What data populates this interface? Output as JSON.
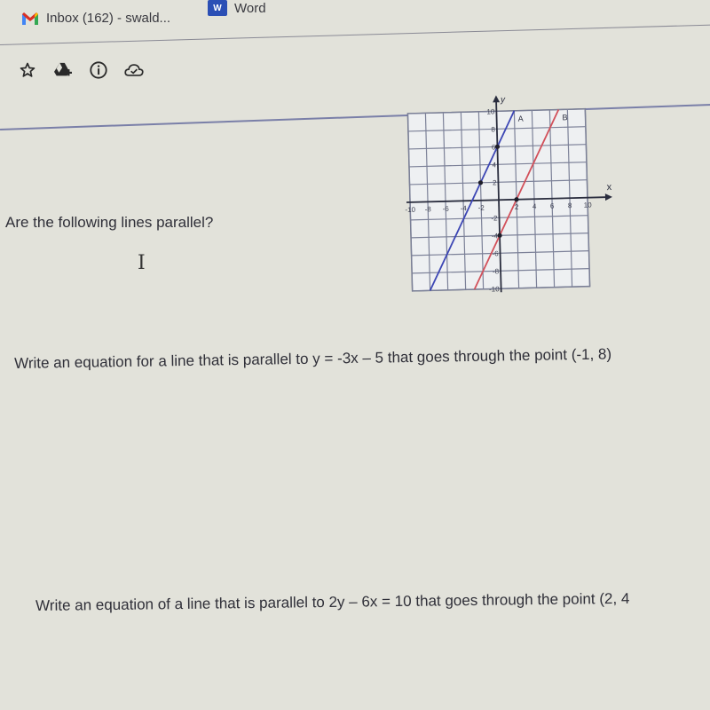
{
  "bookmarks": {
    "items": [
      {
        "label": "Inbox (162) - swald...",
        "icon": "gmail-icon"
      },
      {
        "label": "Word",
        "icon": "word-icon",
        "icon_text": "W"
      }
    ]
  },
  "toolbar": {
    "icons": [
      "star-icon",
      "drive-add-icon",
      "info-icon",
      "cloud-check-icon"
    ]
  },
  "questions": [
    {
      "text": "Are the following lines parallel?"
    },
    {
      "text": "Write an equation for a line that is parallel to y = -3x – 5 that goes through the point (-1, 8)"
    },
    {
      "text": "Write an equation of a line that is parallel to 2y – 6x = 10 that goes through the point (2, 4"
    }
  ],
  "chart_data": {
    "type": "line",
    "title": "",
    "xlabel": "x",
    "ylabel": "y",
    "xlim": [
      -10,
      10
    ],
    "ylim": [
      -10,
      10
    ],
    "grid": true,
    "x_ticks": [
      -10,
      -8,
      -6,
      -4,
      -2,
      2,
      4,
      6,
      8,
      10
    ],
    "y_ticks": [
      -10,
      -8,
      -6,
      -4,
      -2,
      2,
      4,
      6,
      8,
      10
    ],
    "series": [
      {
        "name": "A",
        "color": "#3c46b4",
        "slope": 2,
        "intercept": 6,
        "points": [
          [
            -2,
            2
          ],
          [
            0,
            6
          ]
        ],
        "x_range": [
          -8,
          2
        ]
      },
      {
        "name": "B",
        "color": "#d2505a",
        "slope": 2,
        "intercept": -4,
        "points": [
          [
            0,
            -4
          ],
          [
            2,
            0
          ]
        ],
        "x_range": [
          -3,
          7
        ]
      }
    ]
  }
}
